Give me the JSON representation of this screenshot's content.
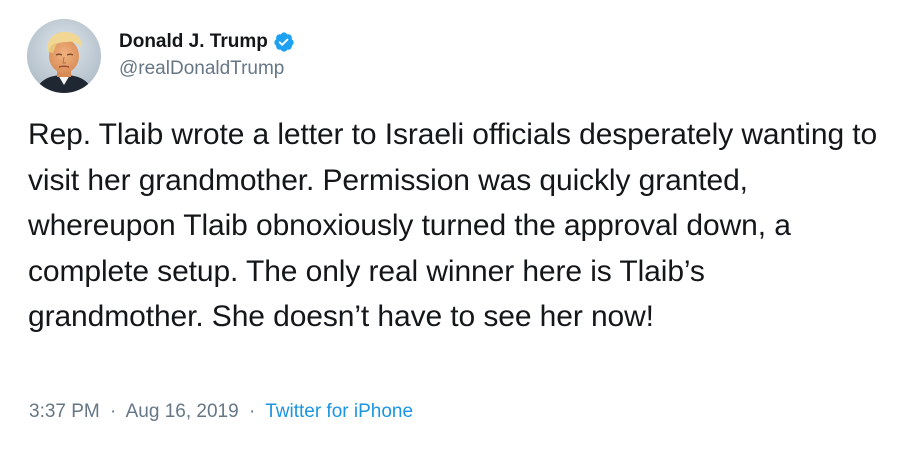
{
  "user": {
    "display_name": "Donald J. Trump",
    "handle": "@realDonaldTrump",
    "verified_icon": "verified-badge-icon",
    "avatar_icon": "profile-photo"
  },
  "tweet": {
    "text": "Rep. Tlaib wrote a letter to Israeli officials desperately wanting to visit her grandmother. Permission was quickly granted, whereupon Tlaib obnoxiously turned the approval down, a complete setup. The only real winner here is Tlaib’s grandmother. She doesn’t have to see her now!",
    "time": "3:37 PM",
    "separator": "·",
    "date": "Aug 16, 2019",
    "source": "Twitter for iPhone"
  },
  "colors": {
    "text": "#14171a",
    "secondary": "#657786",
    "link": "#1b95e0",
    "verified": "#1da1f2"
  }
}
